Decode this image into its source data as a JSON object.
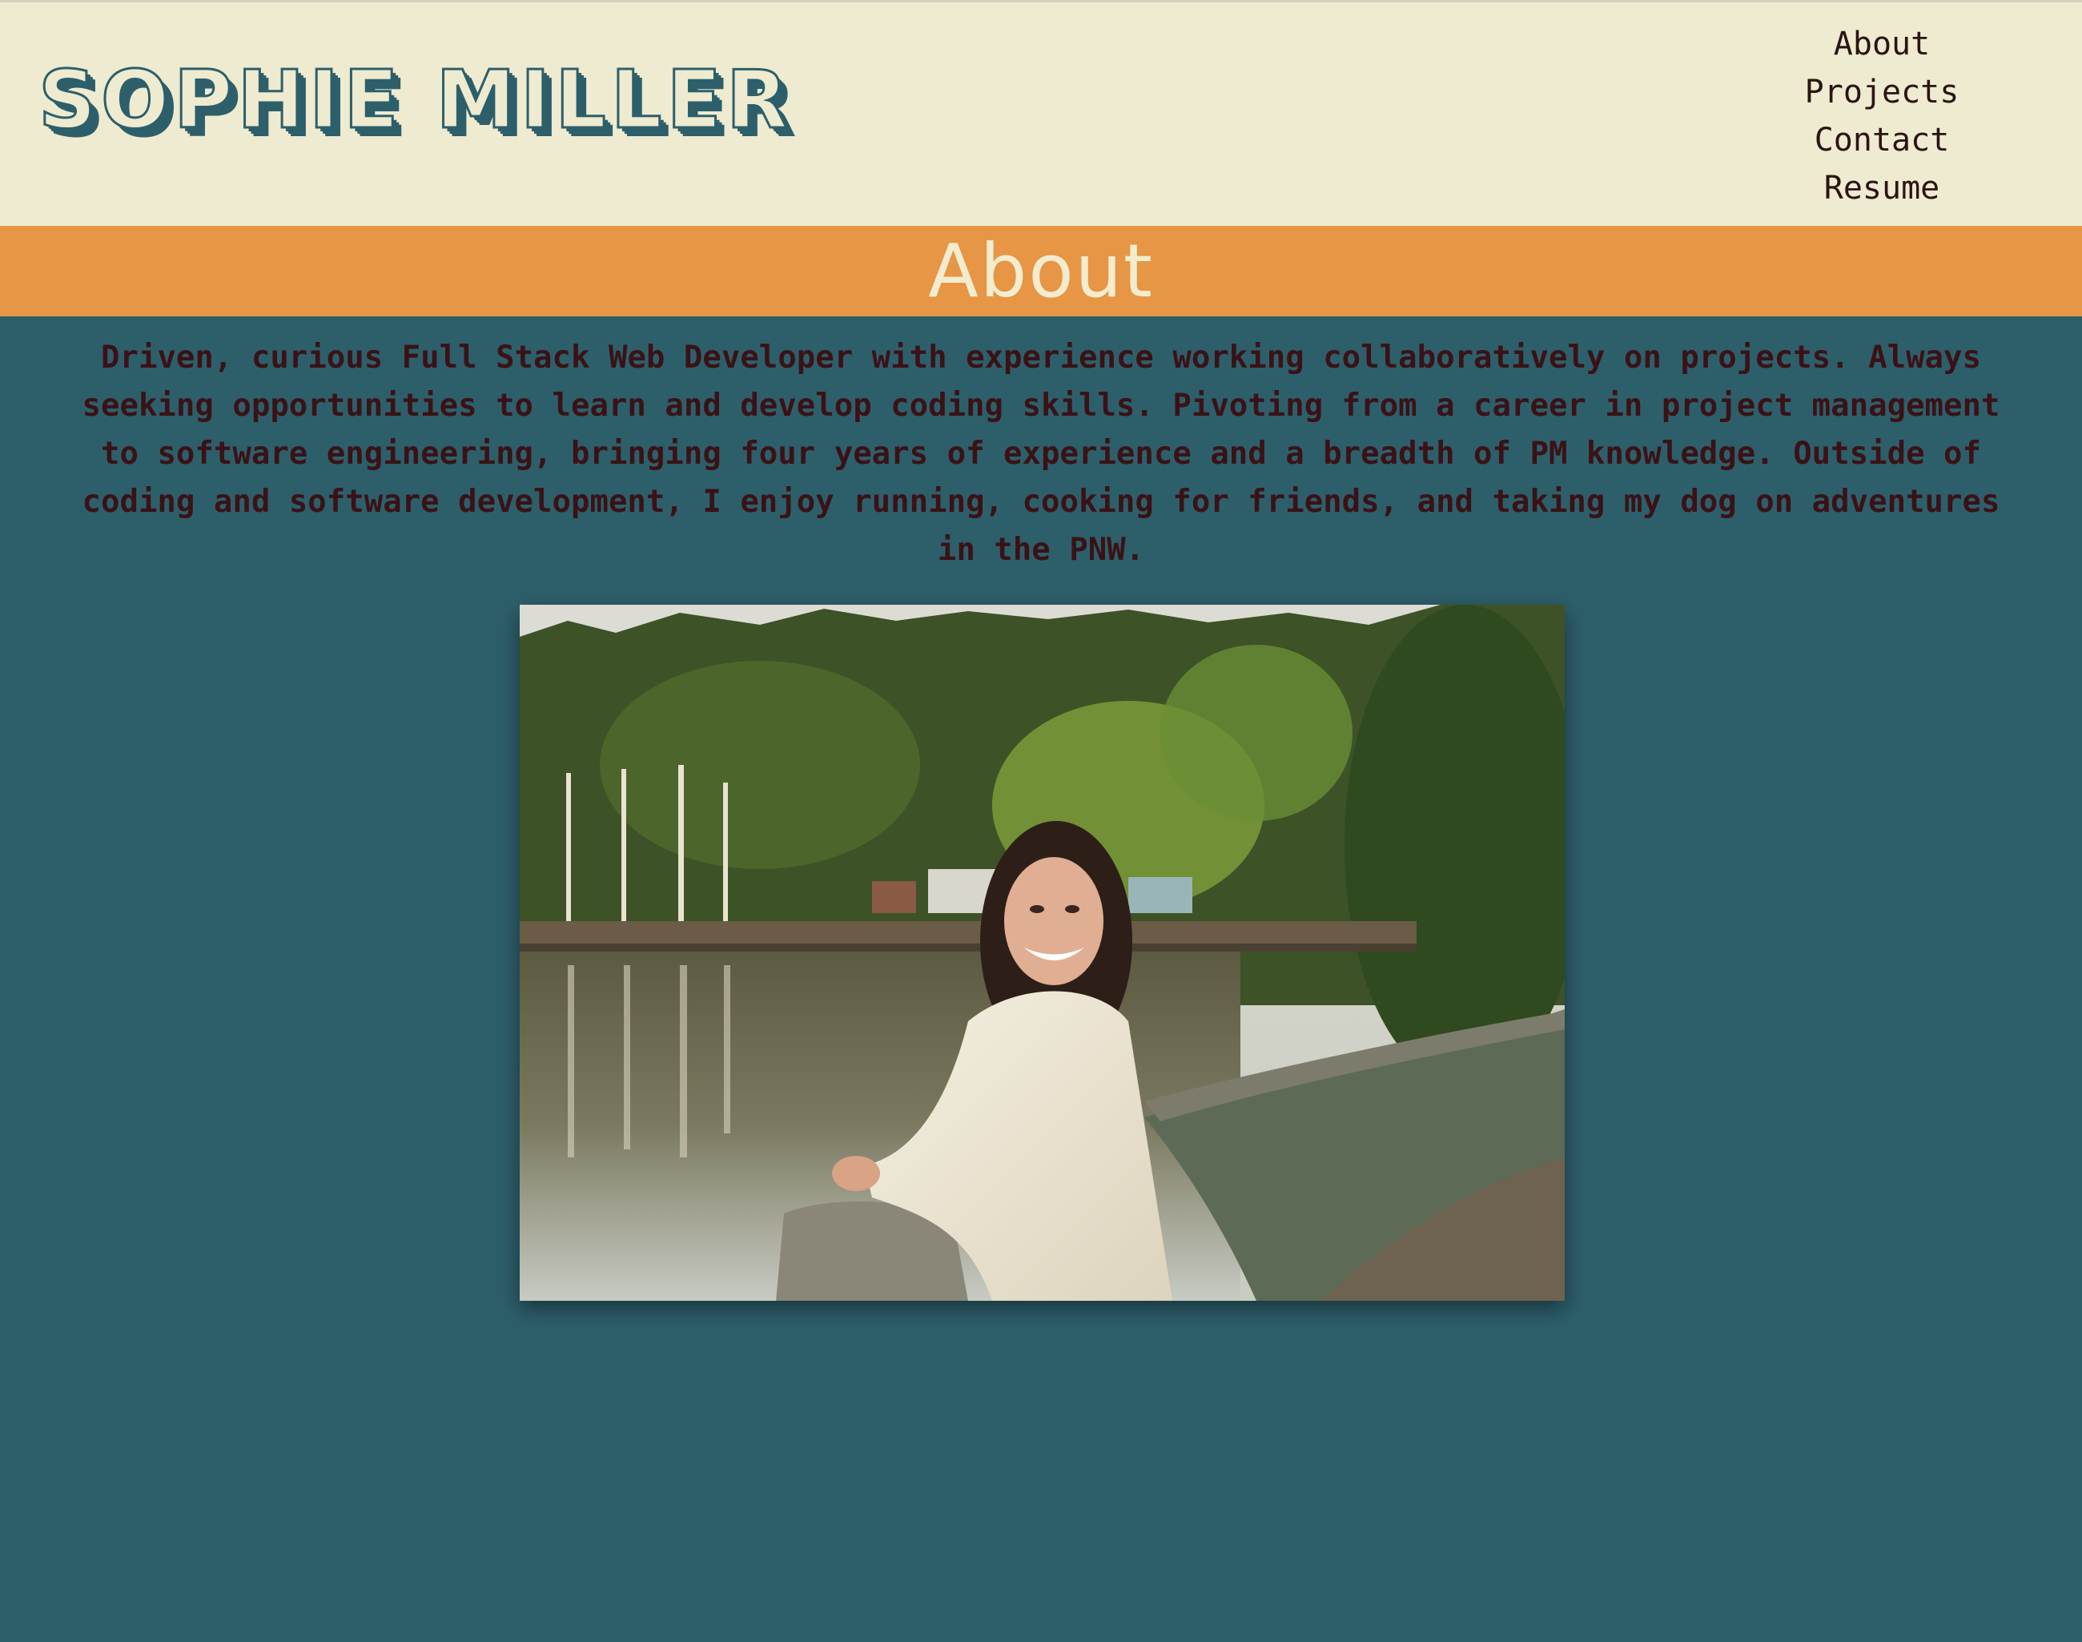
{
  "header": {
    "logo_text": "SOPHIE MILLER",
    "nav": [
      {
        "label": "About"
      },
      {
        "label": "Projects"
      },
      {
        "label": "Contact"
      },
      {
        "label": "Resume"
      }
    ]
  },
  "section": {
    "title": "About",
    "bio": "Driven, curious Full Stack Web Developer with experience working collaboratively on projects. Always seeking opportunities to learn and develop coding skills. Pivoting from a career in project management to software engineering, bringing four years of experience and a breadth of PM knowledge. Outside of coding and software development, I enjoy running, cooking for friends, and taking my dog on adventures in the PNW."
  },
  "colors": {
    "header_bg": "#eeebd0",
    "accent_orange": "#e69644",
    "page_bg": "#2d5f6b",
    "text_dark": "#3a1216"
  }
}
